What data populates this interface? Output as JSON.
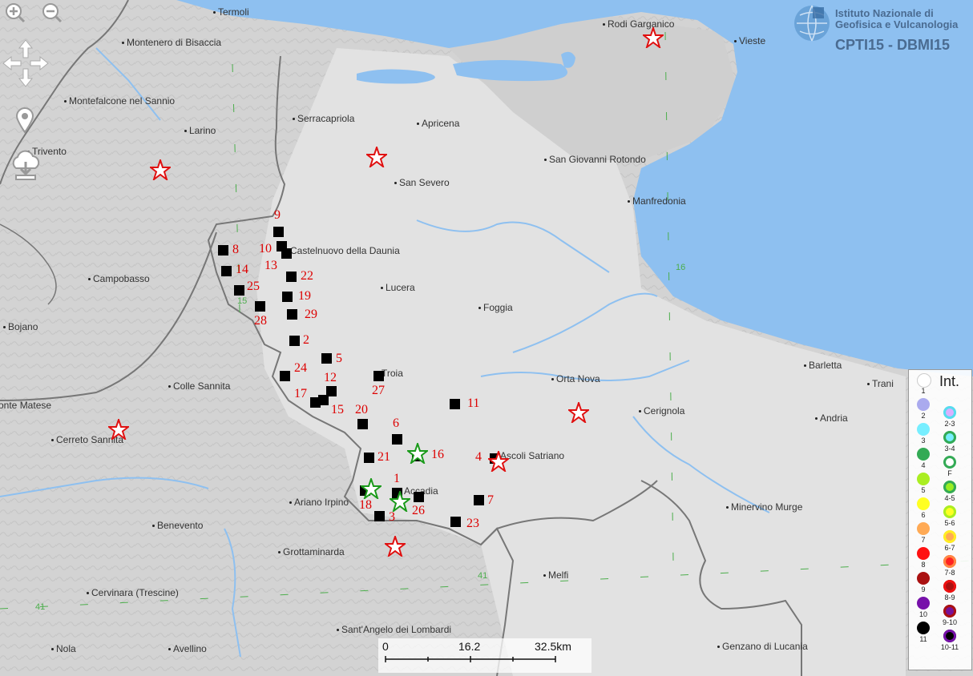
{
  "header": {
    "institute_line1": "Istituto Nazionale di",
    "institute_line2": "Geofisica e Vulcanologia",
    "catalog": "CPTI15 - DBMI15"
  },
  "controls": {
    "zoom_in": "zoom-in-icon",
    "zoom_out": "zoom-out-icon",
    "pan": "pan-arrows-icon",
    "locate": "location-pin-icon",
    "download": "cloud-download-icon"
  },
  "places": [
    {
      "name": "Termoli"
    },
    {
      "name": "Rodi Garganico"
    },
    {
      "name": "Vieste"
    },
    {
      "name": "Montenero di Bisaccia"
    },
    {
      "name": "Montefalcone nel Sannio"
    },
    {
      "name": "Larino"
    },
    {
      "name": "Serracapriola"
    },
    {
      "name": "Apricena"
    },
    {
      "name": "San Giovanni Rotondo"
    },
    {
      "name": "Trivento"
    },
    {
      "name": "San Severo"
    },
    {
      "name": "Manfredonia"
    },
    {
      "name": "Castelnuovo della Daunia"
    },
    {
      "name": "Campobasso"
    },
    {
      "name": "Lucera"
    },
    {
      "name": "Foggia"
    },
    {
      "name": "Bojano"
    },
    {
      "name": "Troia"
    },
    {
      "name": "Orta Nova"
    },
    {
      "name": "Barletta"
    },
    {
      "name": "Trani"
    },
    {
      "name": "Colle Sannita"
    },
    {
      "name": "Cerignola"
    },
    {
      "name": "Andria"
    },
    {
      "name": "onte Matese"
    },
    {
      "name": "Cerreto Sannita"
    },
    {
      "name": "Ascoli Satriano"
    },
    {
      "name": "Accadia"
    },
    {
      "name": "Ariano Irpino"
    },
    {
      "name": "Minervino Murge"
    },
    {
      "name": "Benevento"
    },
    {
      "name": "Grottaminarda"
    },
    {
      "name": "Melfi"
    },
    {
      "name": "Cervinara (Trescine)"
    },
    {
      "name": "Sant'Angelo dei Lombardi"
    },
    {
      "name": "Nola"
    },
    {
      "name": "Avellino"
    },
    {
      "name": "Genzano di Lucania"
    }
  ],
  "intensity_points": [
    {
      "label": "9"
    },
    {
      "label": "8"
    },
    {
      "label": "10"
    },
    {
      "label": "13"
    },
    {
      "label": "14"
    },
    {
      "label": "22"
    },
    {
      "label": "25"
    },
    {
      "label": "19"
    },
    {
      "label": "28"
    },
    {
      "label": "29"
    },
    {
      "label": "2"
    },
    {
      "label": "5"
    },
    {
      "label": "24"
    },
    {
      "label": "12"
    },
    {
      "label": "27"
    },
    {
      "label": "17"
    },
    {
      "label": "15"
    },
    {
      "label": "20"
    },
    {
      "label": "11"
    },
    {
      "label": "6"
    },
    {
      "label": "21"
    },
    {
      "label": "16"
    },
    {
      "label": "4"
    },
    {
      "label": "1"
    },
    {
      "label": "7"
    },
    {
      "label": "18"
    },
    {
      "label": "26"
    },
    {
      "label": "3"
    },
    {
      "label": "23"
    }
  ],
  "stars": [
    {
      "color": "#e01010"
    },
    {
      "color": "#e01010"
    },
    {
      "color": "#e01010"
    },
    {
      "color": "#e01010"
    },
    {
      "color": "#e01010"
    },
    {
      "color": "#e01010"
    },
    {
      "color": "#e01010"
    },
    {
      "color": "#1a9a1a"
    },
    {
      "color": "#1a9a1a"
    },
    {
      "color": "#1a9a1a"
    }
  ],
  "grid_labels": [
    "16",
    "15",
    "41",
    "41"
  ],
  "scale": {
    "s0": "0",
    "s1": "16.2",
    "s2": "32.5km"
  },
  "legend": {
    "title": "Int.",
    "items": [
      {
        "label": "1",
        "color": "#ffffff",
        "ring": ""
      },
      {
        "label": "2",
        "color": "#aaaaee",
        "ring": ""
      },
      {
        "label": "2-3",
        "color": "#d9b0ff",
        "ring": "#55ddee"
      },
      {
        "label": "3",
        "color": "#77eeff",
        "ring": ""
      },
      {
        "label": "3-4",
        "color": "#77eeff",
        "ring": "#33aa55"
      },
      {
        "label": "F",
        "color": "#ffffff",
        "ring": "#33aa55"
      },
      {
        "label": "4",
        "color": "#33aa55",
        "ring": ""
      },
      {
        "label": "4-5",
        "color": "#99ee22",
        "ring": "#33aa55"
      },
      {
        "label": "5",
        "color": "#aaee22",
        "ring": ""
      },
      {
        "label": "5-6",
        "color": "#ffff22",
        "ring": "#aaee22"
      },
      {
        "label": "6",
        "color": "#ffff22",
        "ring": ""
      },
      {
        "label": "6-7",
        "color": "#ffaa55",
        "ring": "#ffee22"
      },
      {
        "label": "7",
        "color": "#ffaa55",
        "ring": ""
      },
      {
        "label": "7-8",
        "color": "#ff2222",
        "ring": "#ff8844"
      },
      {
        "label": "8",
        "color": "#ff1111",
        "ring": ""
      },
      {
        "label": "8-9",
        "color": "#aa1111",
        "ring": "#ee1111"
      },
      {
        "label": "9",
        "color": "#aa1111",
        "ring": ""
      },
      {
        "label": "9-10",
        "color": "#771199",
        "ring": "#aa1111"
      },
      {
        "label": "10",
        "color": "#7711aa",
        "ring": ""
      },
      {
        "label": "10-11",
        "color": "#000000",
        "ring": "#7711aa"
      },
      {
        "label": "11",
        "color": "#000000",
        "ring": ""
      }
    ]
  }
}
